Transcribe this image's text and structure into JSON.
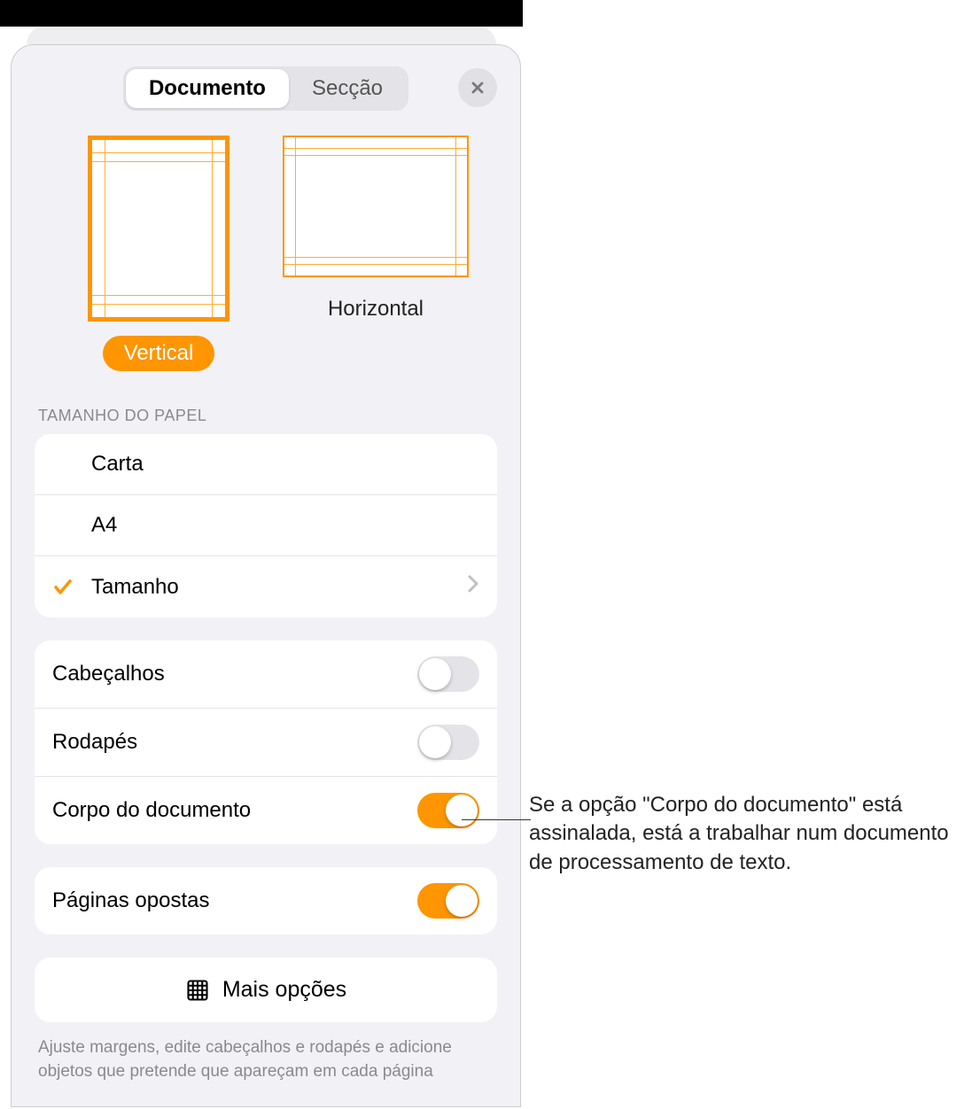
{
  "tabs": {
    "document": "Documento",
    "section": "Secção"
  },
  "orientation": {
    "vertical": "Vertical",
    "horizontal": "Horizontal"
  },
  "paperSize": {
    "header": "Tamanho do papel",
    "options": {
      "letter": "Carta",
      "a4": "A4",
      "custom": "Tamanho"
    }
  },
  "toggles": {
    "headers": "Cabeçalhos",
    "footers": "Rodapés",
    "documentBody": "Corpo do documento",
    "facingPages": "Páginas opostas"
  },
  "moreOptions": "Mais opções",
  "footerHint": "Ajuste margens, edite cabeçalhos e rodapés e adicione objetos que pretende que apareçam em cada página",
  "callout": "Se a opção \"Corpo do documento\" está assinalada, está a trabalhar num documento de processamento de texto."
}
